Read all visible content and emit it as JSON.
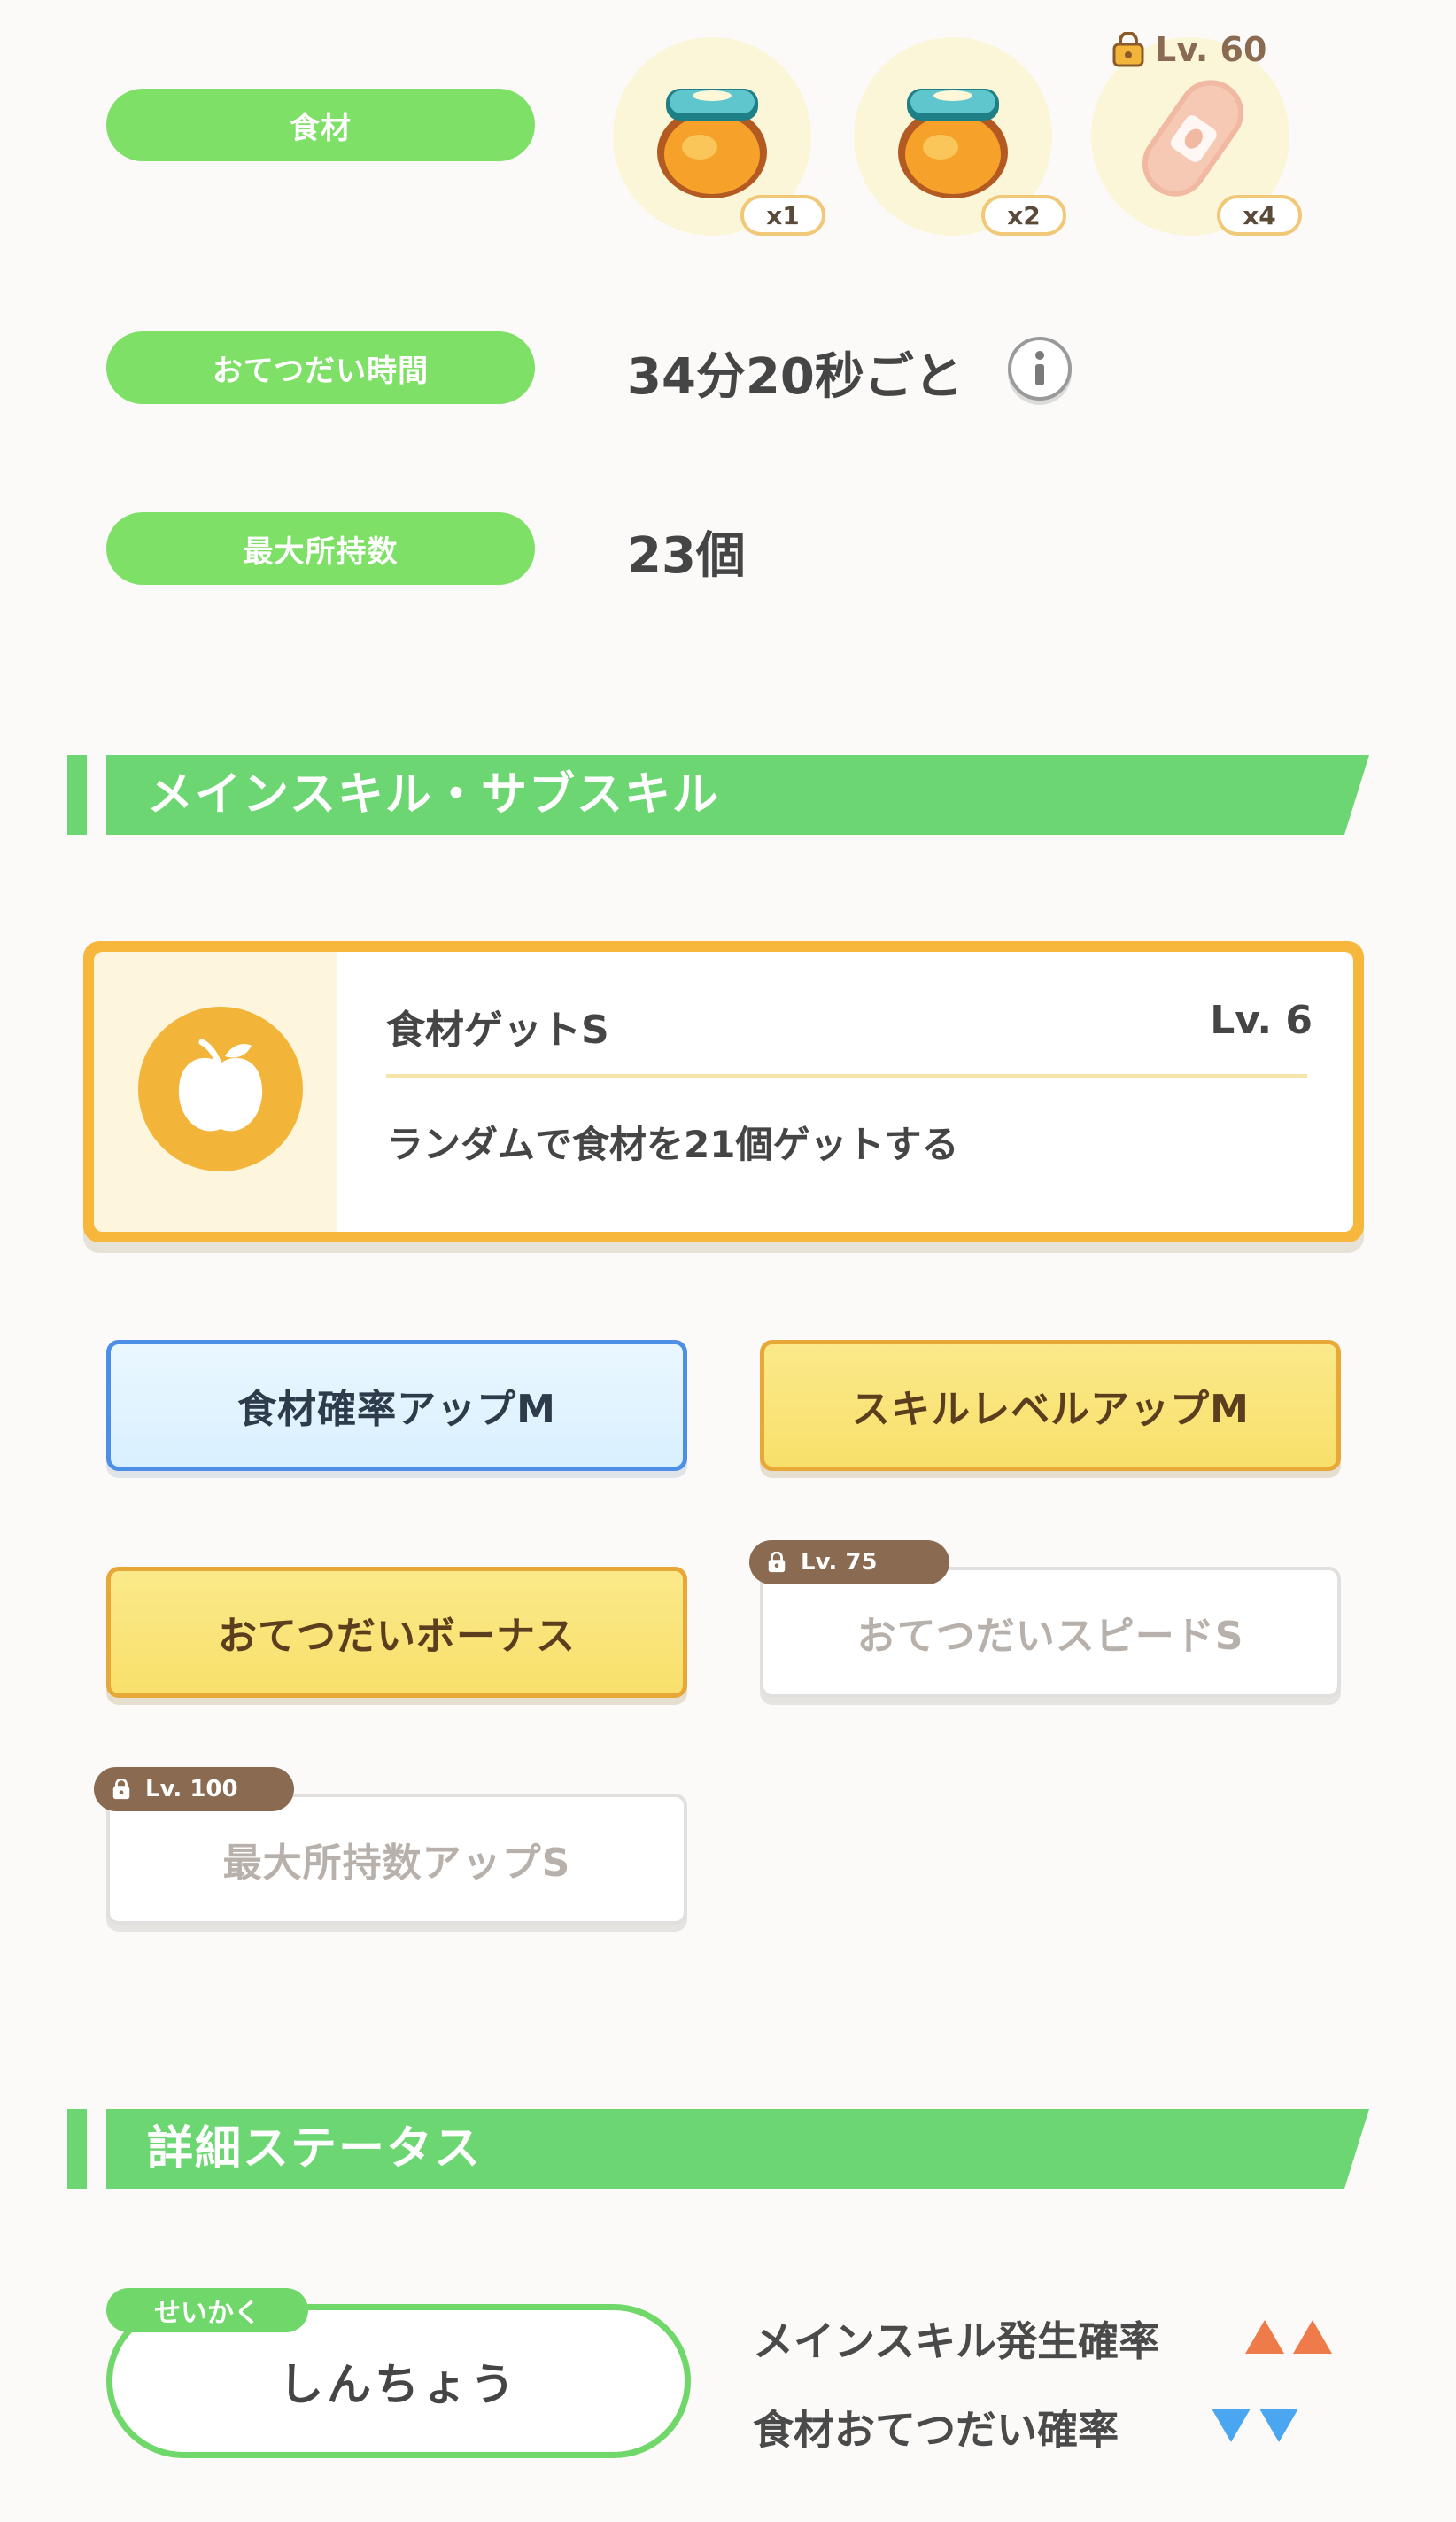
{
  "info_rows": {
    "ingredients_label": "食材",
    "help_time_label": "おてつだい時間",
    "help_time_value": "34分20秒ごと",
    "max_carry_label": "最大所持数",
    "max_carry_value": "23個"
  },
  "ingredients": [
    {
      "name": "honey-jar",
      "qty": "x1"
    },
    {
      "name": "honey-jar",
      "qty": "x2"
    },
    {
      "name": "bean-sausage",
      "qty": "x4",
      "unlock": "Lv. 60"
    }
  ],
  "skills_section": {
    "title": "メインスキル・サブスキル",
    "main_skill": {
      "name": "食材ゲットS",
      "level": "Lv. 6",
      "description": "ランダムで食材を21個ゲットする"
    },
    "sub_skills": [
      {
        "label": "食材確率アップM",
        "style": "blue"
      },
      {
        "label": "スキルレベルアップM",
        "style": "gold"
      },
      {
        "label": "おてつだいボーナス",
        "style": "gold"
      },
      {
        "label": "おてつだいスピードS",
        "style": "locked",
        "unlock": "Lv. 75"
      },
      {
        "label": "最大所持数アップS",
        "style": "locked",
        "unlock": "Lv. 100"
      }
    ]
  },
  "status_section": {
    "title": "詳細ステータス",
    "nature_tag": "せいかく",
    "nature": "しんちょう",
    "effects": [
      {
        "label": "メインスキル発生確率",
        "direction": "up",
        "color": "#ef7a4a"
      },
      {
        "label": "食材おてつだい確率",
        "direction": "down",
        "color": "#4aa6f0"
      }
    ]
  }
}
